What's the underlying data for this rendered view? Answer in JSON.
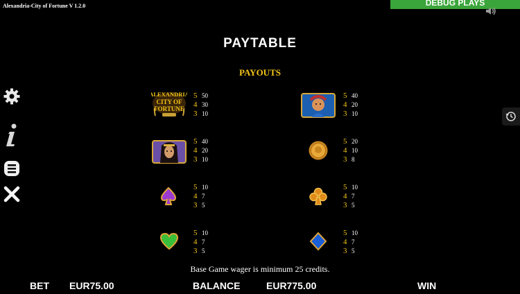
{
  "window": {
    "title": "Alexandria-City of Fortune   V 1.2.0"
  },
  "debug": {
    "label": "DEBUG PLAYS"
  },
  "paytable": {
    "title": "PAYTABLE",
    "subtitle": "PAYOUTS",
    "symbols": [
      {
        "name": "logo",
        "label_lines": [
          "ALEXANDRIA",
          "CITY OF",
          "FORTUNE"
        ],
        "counts": [
          "5",
          "4",
          "3"
        ],
        "pays": [
          "50",
          "30",
          "10"
        ]
      },
      {
        "name": "king",
        "counts": [
          "5",
          "4",
          "3"
        ],
        "pays": [
          "40",
          "20",
          "10"
        ]
      },
      {
        "name": "queen",
        "counts": [
          "5",
          "4",
          "3"
        ],
        "pays": [
          "40",
          "20",
          "10"
        ]
      },
      {
        "name": "coin",
        "counts": [
          "5",
          "4",
          "3"
        ],
        "pays": [
          "20",
          "10",
          "8"
        ]
      },
      {
        "name": "spade",
        "counts": [
          "5",
          "4",
          "3"
        ],
        "pays": [
          "10",
          "7",
          "5"
        ]
      },
      {
        "name": "club",
        "counts": [
          "5",
          "4",
          "3"
        ],
        "pays": [
          "10",
          "7",
          "5"
        ]
      },
      {
        "name": "heart",
        "counts": [
          "5",
          "4",
          "3"
        ],
        "pays": [
          "10",
          "7",
          "5"
        ]
      },
      {
        "name": "diamond",
        "counts": [
          "5",
          "4",
          "3"
        ],
        "pays": [
          "10",
          "7",
          "5"
        ]
      }
    ],
    "note": "Base Game wager is minimum 25 credits."
  },
  "footer": {
    "bet_label": "BET",
    "bet_value": "EUR75.00",
    "balance_label": "BALANCE",
    "balance_value": "EUR775.00",
    "win_label": "WIN"
  },
  "colors": {
    "accent": "#f5c518",
    "debug": "#3aa53a",
    "background": "#000000"
  },
  "icons": [
    "gear-icon",
    "info-icon",
    "menu-icon",
    "close-icon",
    "speaker-icon",
    "history-icon"
  ]
}
